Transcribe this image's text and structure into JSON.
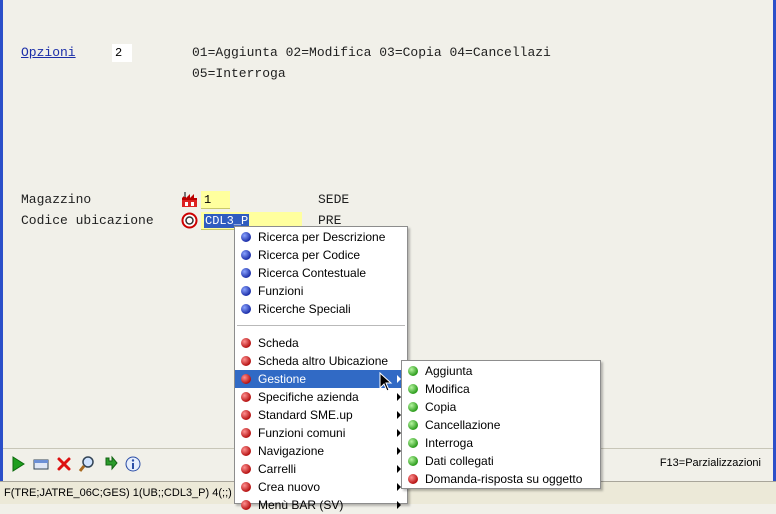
{
  "header": {
    "opzioni_label": "Opzioni",
    "opzioni_value": "2",
    "options_line1": "01=Aggiunta 02=Modifica 03=Copia 04=Cancellazi",
    "options_line2": "05=Interroga"
  },
  "form": {
    "magazzino_label": "Magazzino",
    "magazzino_value": "1",
    "magazzino_desc": "SEDE",
    "codice_label": "Codice ubicazione",
    "codice_value": "CDL3_P",
    "codice_desc": "PRE"
  },
  "context_menu": {
    "items": [
      {
        "label": "Ricerca per Descrizione",
        "color": "blue"
      },
      {
        "label": "Ricerca per Codice",
        "color": "blue"
      },
      {
        "label": "Ricerca Contestuale",
        "color": "blue"
      },
      {
        "label": "Funzioni",
        "color": "blue"
      },
      {
        "label": "Ricerche Speciali",
        "color": "blue"
      },
      {
        "label": "Scheda",
        "color": "red"
      },
      {
        "label": "Scheda altro Ubicazione",
        "color": "red"
      },
      {
        "label": "Gestione",
        "color": "red",
        "submenu": true,
        "highlighted": true
      },
      {
        "label": "Specifiche azienda",
        "color": "red",
        "submenu": true
      },
      {
        "label": "Standard SME.up",
        "color": "red",
        "submenu": true
      },
      {
        "label": "Funzioni comuni",
        "color": "red",
        "submenu": true
      },
      {
        "label": "Navigazione",
        "color": "red",
        "submenu": true
      },
      {
        "label": "Carrelli",
        "color": "red",
        "submenu": true
      },
      {
        "label": "Crea nuovo",
        "color": "red",
        "submenu": true
      },
      {
        "label": "Menù BAR (SV)",
        "color": "red",
        "submenu": true
      }
    ]
  },
  "submenu": {
    "items": [
      {
        "label": "Aggiunta",
        "color": "green"
      },
      {
        "label": "Modifica",
        "color": "green"
      },
      {
        "label": "Copia",
        "color": "green"
      },
      {
        "label": "Cancellazione",
        "color": "green"
      },
      {
        "label": "Interroga",
        "color": "green"
      },
      {
        "label": "Dati collegati",
        "color": "green"
      },
      {
        "label": "Domanda-risposta su oggetto",
        "color": "red"
      }
    ]
  },
  "toolbar": {
    "icons": [
      "run-icon",
      "window-icon",
      "cancel-icon",
      "search-icon",
      "refresh-icon",
      "info-icon"
    ],
    "f13_label": "F13=Parzializzazioni"
  },
  "status_bar": {
    "text": "F(TRE;JATRE_06C;GES) 1(UB;;CDL3_P) 4(;;)"
  }
}
